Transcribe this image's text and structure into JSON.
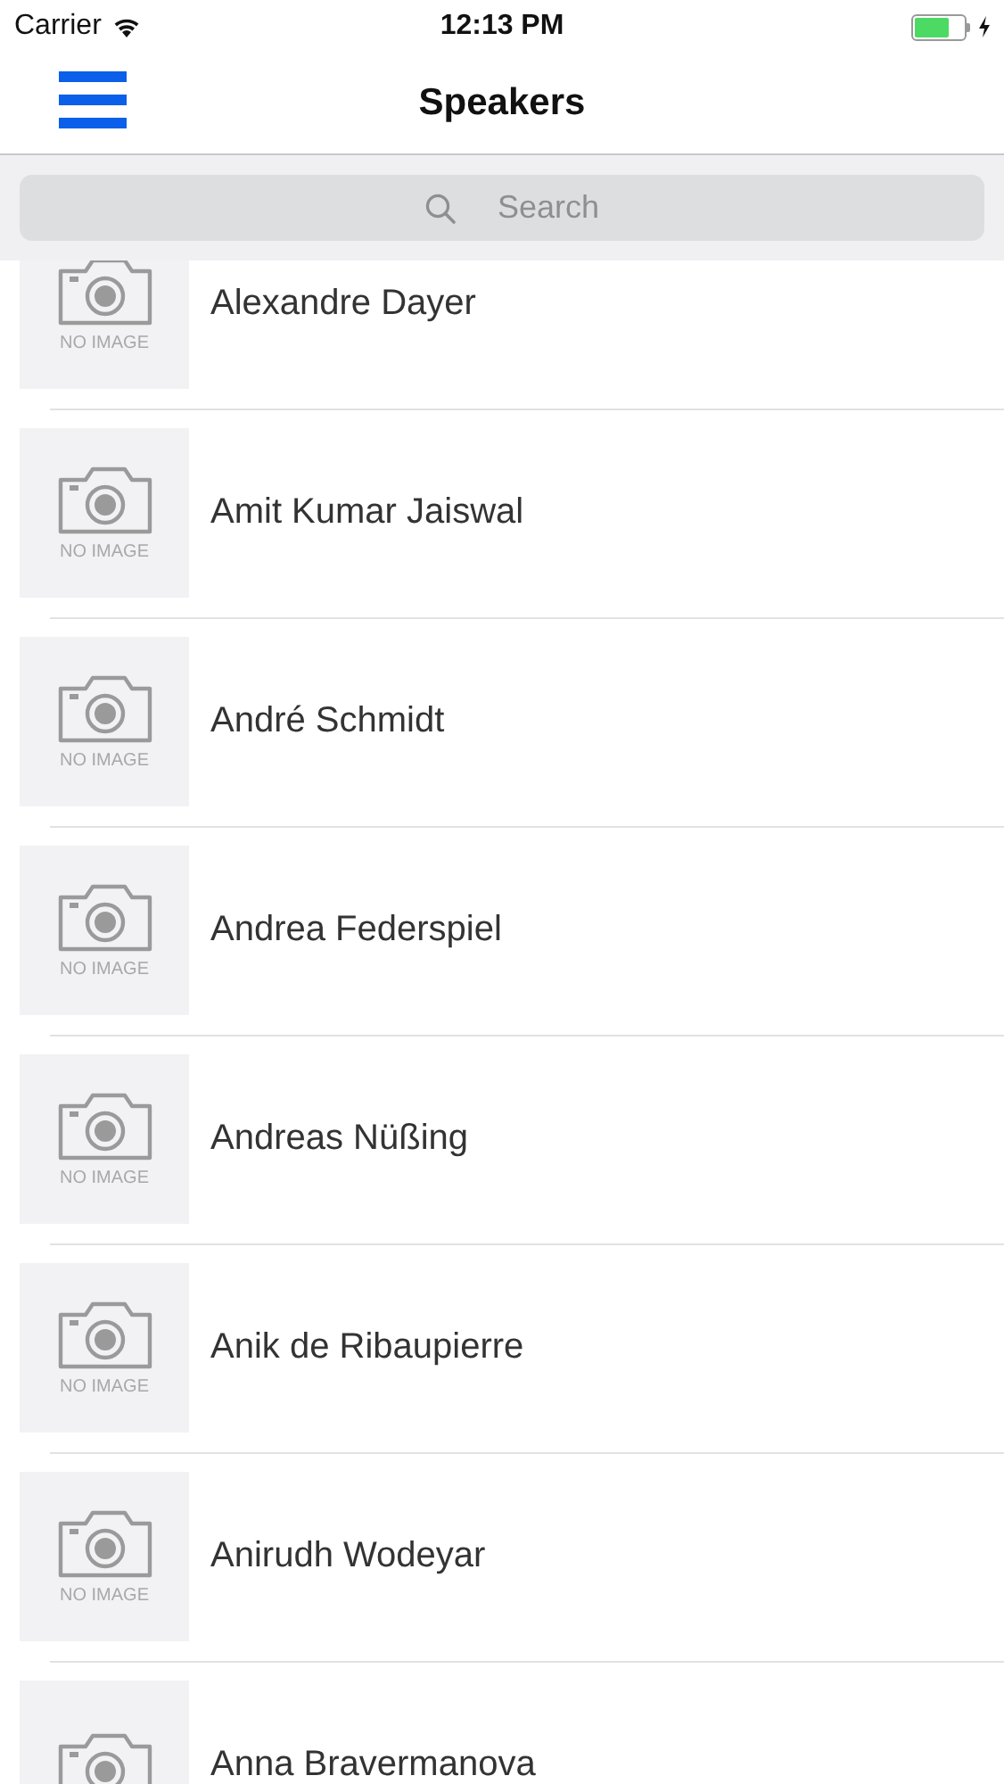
{
  "status_bar": {
    "carrier": "Carrier",
    "time": "12:13 PM",
    "charging": true,
    "battery": {
      "level": 0.7
    }
  },
  "nav": {
    "title": "Speakers"
  },
  "search": {
    "placeholder": "Search"
  },
  "speakers": [
    {
      "name": "Alexandre Dayer",
      "image_label": "NO IMAGE"
    },
    {
      "name": "Amit Kumar Jaiswal",
      "image_label": "NO IMAGE"
    },
    {
      "name": "André Schmidt",
      "image_label": "NO IMAGE"
    },
    {
      "name": "Andrea Federspiel",
      "image_label": "NO IMAGE"
    },
    {
      "name": "Andreas Nüßing",
      "image_label": "NO IMAGE"
    },
    {
      "name": "Anik de Ribaupierre",
      "image_label": "NO IMAGE"
    },
    {
      "name": "Anirudh Wodeyar",
      "image_label": "NO IMAGE"
    },
    {
      "name": "Anna Bravermanova"
    }
  ]
}
